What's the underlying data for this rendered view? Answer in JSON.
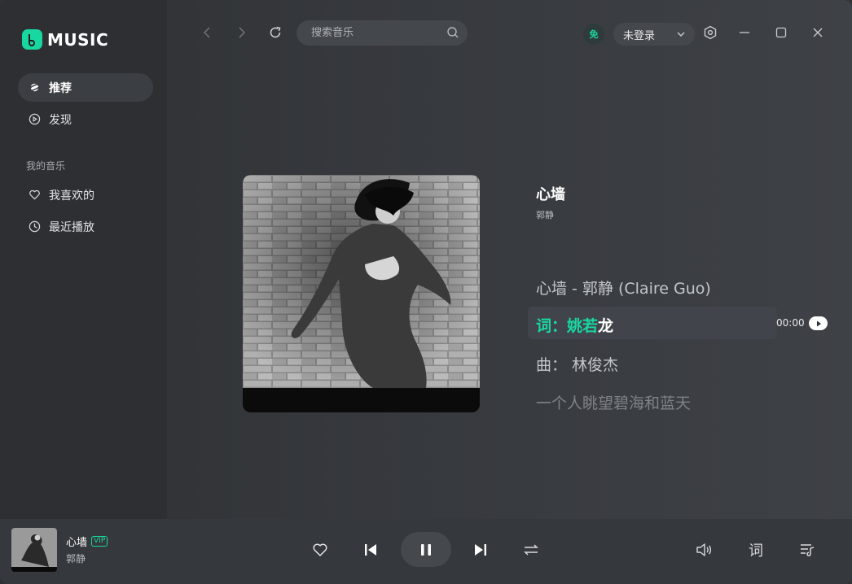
{
  "app": {
    "logo_text": "MUSIC"
  },
  "sidebar": {
    "items": [
      {
        "label": "推荐",
        "icon": "planet-icon",
        "active": true
      },
      {
        "label": "发现",
        "icon": "play-circle-icon",
        "active": false
      }
    ],
    "section_title": "我的音乐",
    "my_music": [
      {
        "label": "我喜欢的",
        "icon": "heart-icon"
      },
      {
        "label": "最近播放",
        "icon": "clock-icon"
      }
    ]
  },
  "topbar": {
    "search_placeholder": "搜索音乐",
    "vip_badge": "免",
    "login_label": "未登录"
  },
  "song": {
    "title": "心墙",
    "artist": "郭静"
  },
  "lyrics": {
    "line1": "心墙 - 郭静 (Claire Guo)",
    "active_prefix": "词：",
    "active_hl": "姚若",
    "active_rest": "龙",
    "line3": "曲：  林俊杰",
    "line4": "一个人眺望碧海和蓝天",
    "time": "00:00"
  },
  "player": {
    "title": "心墙",
    "vip": "VIP",
    "artist": "郭静",
    "lyrics_button": "词"
  },
  "colors": {
    "accent": "#19d7a1",
    "background": "#303236",
    "sidebar": "#2d2f33"
  }
}
